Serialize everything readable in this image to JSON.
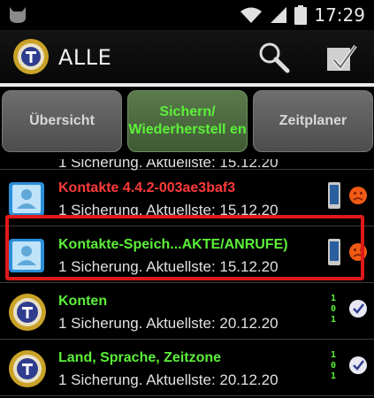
{
  "status_bar": {
    "time": "17:29"
  },
  "action_bar": {
    "title": "ALLE"
  },
  "tabs": [
    {
      "label": "Übersicht"
    },
    {
      "label": "Sichern/ Wiederherstell en"
    },
    {
      "label": "Zeitplaner"
    }
  ],
  "list": {
    "partial_subtitle": "1 Sicherung. Aktuellste: 15.12.20",
    "items": [
      {
        "title": "Kontakte 4.4.2-003ae3baf3",
        "subtitle": "1 Sicherung. Aktuellste: 15.12.20",
        "title_color": "#ff3b3b"
      },
      {
        "title": "Kontakte-Speich...AKTE/ANRUFE)",
        "subtitle": "1 Sicherung. Aktuellste: 15.12.20",
        "title_color": "#5cf03a"
      },
      {
        "title": "Konten",
        "subtitle": "1 Sicherung. Aktuellste: 20.12.20",
        "title_color": "#5cf03a"
      },
      {
        "title": "Land, Sprache, Zeitzone",
        "subtitle": "1 Sicherung. Aktuellste: 20.12.20",
        "title_color": "#5cf03a"
      }
    ]
  },
  "colors": {
    "highlight": "#e01919",
    "accent_green": "#5cf03a",
    "warning_red": "#ff3b3b"
  },
  "icons": [
    "android-cat-icon",
    "wifi-icon",
    "signal-icon",
    "battery-icon",
    "titanium-logo-icon",
    "search-icon",
    "checkbox-icon",
    "contacts-icon",
    "phone-device-icon",
    "orange-face-icon",
    "binary-101-icon",
    "check-badge-icon"
  ]
}
